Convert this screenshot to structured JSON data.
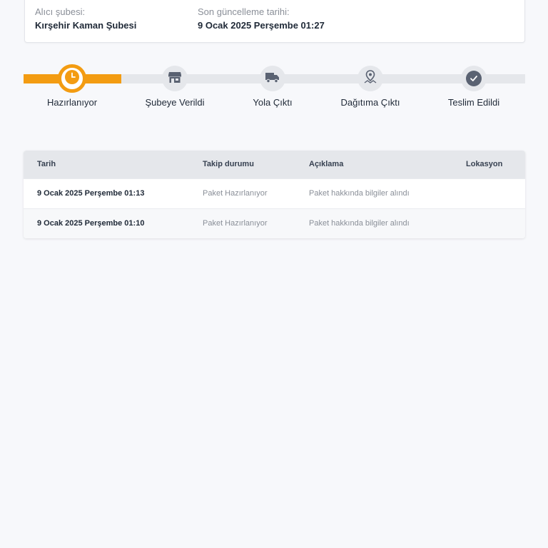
{
  "info": {
    "recipient_branch_label": "Alıcı şubesi:",
    "recipient_branch_value": "Kırşehir Kaman Şubesi",
    "last_update_label": "Son güncelleme tarihi:",
    "last_update_value": "9 Ocak 2025 Perşembe 01:27"
  },
  "stepper": {
    "progress_fraction": 0.2,
    "active_color": "#f39c12",
    "steps": [
      {
        "label": "Hazırlanıyor",
        "icon": "clock-icon",
        "state": "active"
      },
      {
        "label": "Şubeye Verildi",
        "icon": "store-icon",
        "state": "pending"
      },
      {
        "label": "Yola Çıktı",
        "icon": "truck-icon",
        "state": "pending"
      },
      {
        "label": "Dağıtıma Çıktı",
        "icon": "map-pin-icon",
        "state": "pending"
      },
      {
        "label": "Teslim Edildi",
        "icon": "check-circle-icon",
        "state": "pending"
      }
    ]
  },
  "table": {
    "headers": [
      "Tarih",
      "Takip durumu",
      "Açıklama",
      "Lokasyon"
    ],
    "rows": [
      [
        "9 Ocak 2025 Perşembe 01:13",
        "Paket Hazırlanıyor",
        "Paket hakkında bilgiler alındı",
        ""
      ],
      [
        "9 Ocak 2025 Perşembe 01:10",
        "Paket Hazırlanıyor",
        "Paket hakkında bilgiler alındı",
        ""
      ]
    ]
  }
}
